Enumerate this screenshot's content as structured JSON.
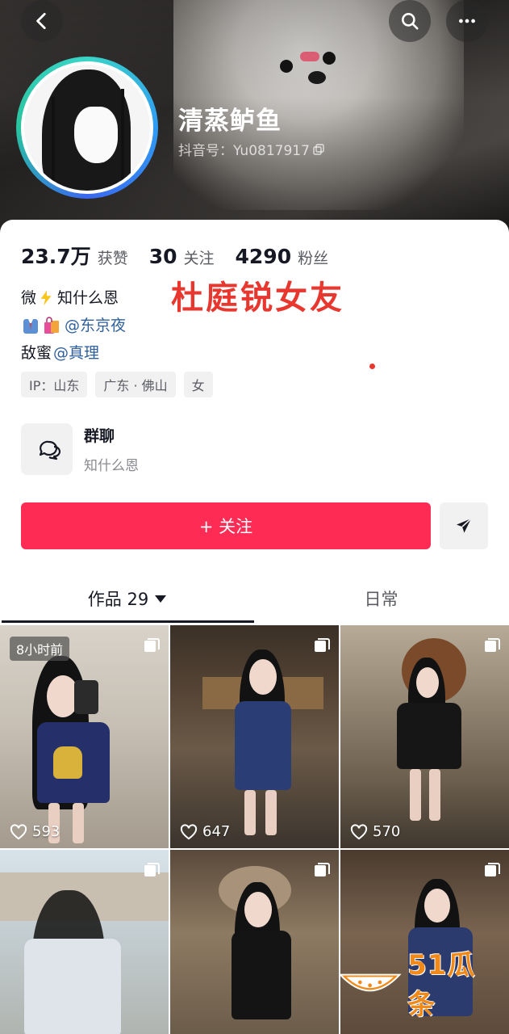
{
  "header": {
    "nickname": "清蒸鲈鱼",
    "douyin_id": "抖音号：Yu0817917",
    "back_icon": "chevron-left-icon",
    "search_icon": "search-icon",
    "more_icon": "more-icon"
  },
  "stats": [
    {
      "num": "23.7万",
      "label": "获赞"
    },
    {
      "num": "30",
      "label": "关注"
    },
    {
      "num": "4290",
      "label": "粉丝"
    }
  ],
  "bio": {
    "line1": "知什么恩",
    "line1_prefix": "微",
    "line2_mention": "@东京夜",
    "line3_text": "敌蜜",
    "line3_mention": "@真理"
  },
  "overlay_title": "杜庭锐女友",
  "tags": [
    "IP：山东",
    "广东 · 佛山",
    "女"
  ],
  "group_chat": {
    "title": "群聊",
    "subtitle": "知什么恩"
  },
  "actions": {
    "follow_label": "+ 关注"
  },
  "tabs": {
    "works_label": "作品 29",
    "daily_label": "日常"
  },
  "posts": [
    {
      "likes": "593",
      "time": "8小时前"
    },
    {
      "likes": "647"
    },
    {
      "likes": "570"
    },
    {},
    {},
    {}
  ],
  "watermark": "51瓜条",
  "colors": {
    "accent": "#fe2c55",
    "mention": "#2f5f9c",
    "overlay_red": "#e8372f"
  }
}
